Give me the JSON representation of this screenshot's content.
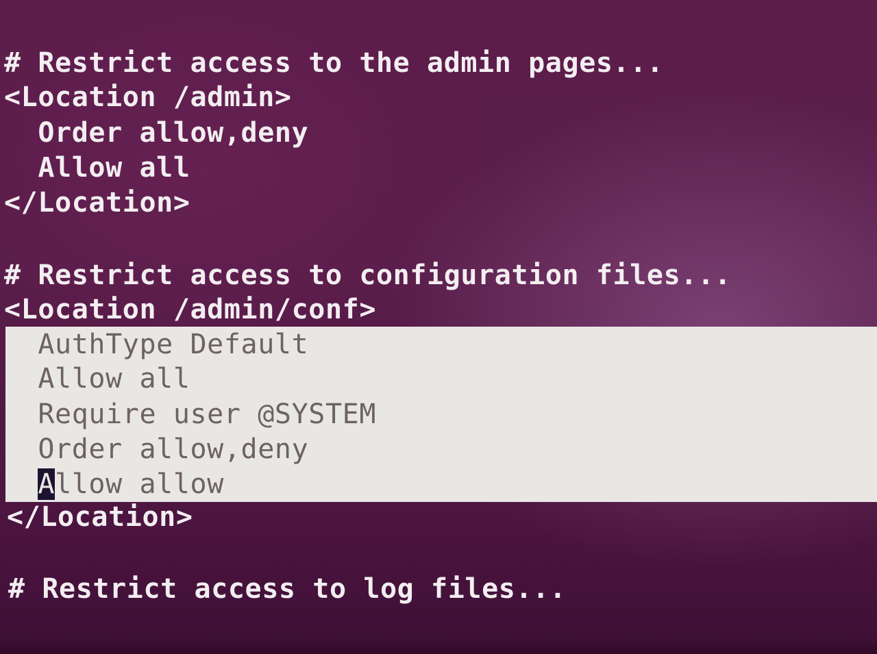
{
  "terminal": {
    "lines": [
      "# Restrict access to the admin pages...",
      "<Location /admin>",
      "  Order allow,deny",
      "  Allow all",
      "</Location>",
      "",
      "# Restrict access to configuration files...",
      "<Location /admin/conf>",
      "  AuthType Default",
      "  Allow all",
      "  Require user @SYSTEM",
      "  Order allow,deny",
      "  Allow allow",
      "</Location>",
      "",
      "# Restrict access to log files..."
    ],
    "cursor_line_prefix": "  ",
    "cursor_char": "A",
    "cursor_line_rest": "llow allow"
  },
  "colors": {
    "background": "#5a1d4a",
    "text": "#f3eef1",
    "selection_background": "#e9e7e4",
    "selection_text": "#6d6266",
    "cursor": "#1f1230"
  }
}
